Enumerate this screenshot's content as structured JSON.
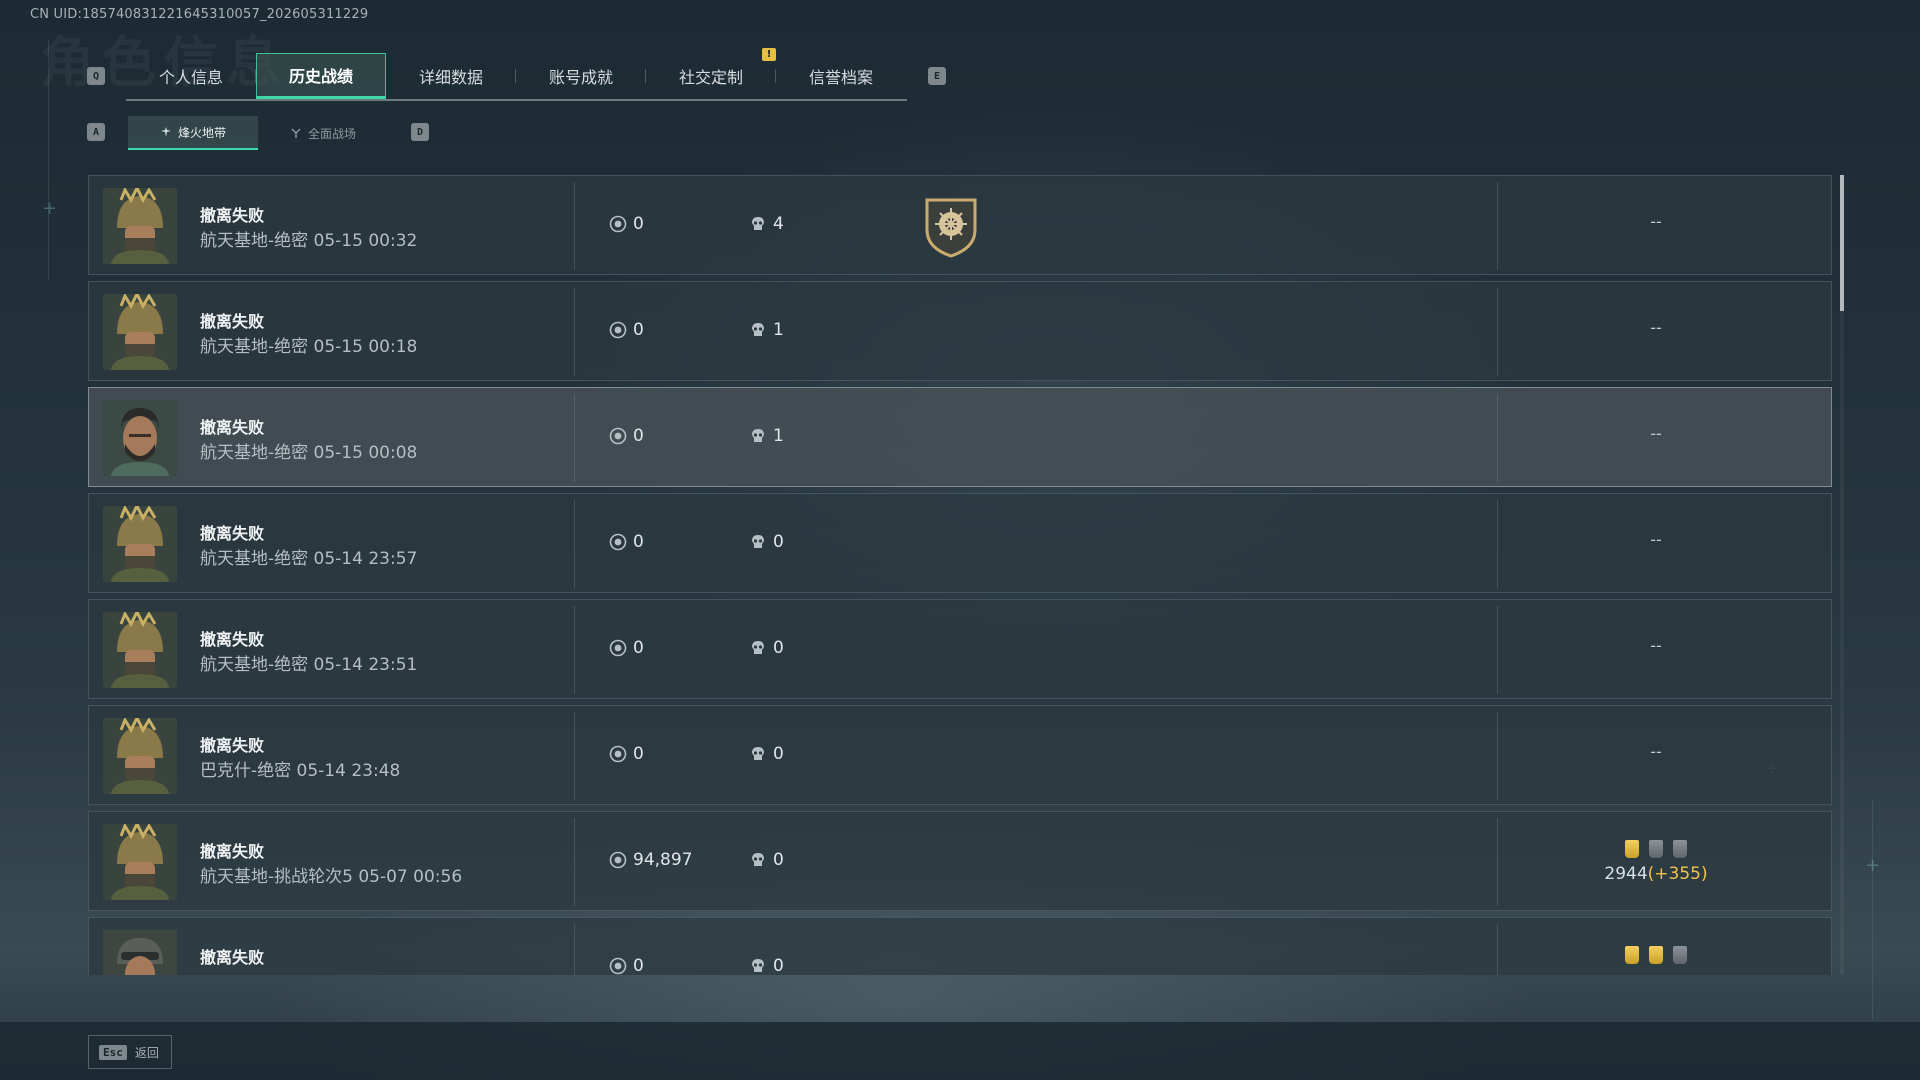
{
  "header": {
    "uid": "CN UID:1857408312216453100​57_202605311229",
    "bg_title": "角色信息"
  },
  "keys": {
    "prev_tab": "Q",
    "next_tab": "E",
    "prev_sub": "A",
    "next_sub": "D"
  },
  "tabs": [
    {
      "label": "个人信息",
      "active": false
    },
    {
      "label": "历史战绩",
      "active": true
    },
    {
      "label": "详细数据",
      "active": false
    },
    {
      "label": "账号成就",
      "active": false
    },
    {
      "label": "社交定制",
      "active": false,
      "notify": "!"
    },
    {
      "label": "信誉档案",
      "active": false
    }
  ],
  "subtabs": [
    {
      "label": "烽火地带",
      "icon": "hazard-zone-icon",
      "active": true
    },
    {
      "label": "全面战场",
      "icon": "battlefield-icon",
      "active": false
    }
  ],
  "matches": [
    {
      "avatar": "helmet-soldier",
      "result": "撤离失败",
      "detail": "航天基地-绝密 05-15 00:32",
      "value": "0",
      "kills": "4",
      "badge": true,
      "rank": "--",
      "highlight": false
    },
    {
      "avatar": "helmet-soldier",
      "result": "撤离失败",
      "detail": "航天基地-绝密 05-15 00:18",
      "value": "0",
      "kills": "1",
      "badge": false,
      "rank": "--",
      "highlight": false
    },
    {
      "avatar": "bearded-soldier",
      "result": "撤离失败",
      "detail": "航天基地-绝密 05-15 00:08",
      "value": "0",
      "kills": "1",
      "badge": false,
      "rank": "--",
      "highlight": true
    },
    {
      "avatar": "helmet-soldier",
      "result": "撤离失败",
      "detail": "航天基地-绝密 05-14 23:57",
      "value": "0",
      "kills": "0",
      "badge": false,
      "rank": "--",
      "highlight": false
    },
    {
      "avatar": "helmet-soldier",
      "result": "撤离失败",
      "detail": "航天基地-绝密 05-14 23:51",
      "value": "0",
      "kills": "0",
      "badge": false,
      "rank": "--",
      "highlight": false
    },
    {
      "avatar": "helmet-soldier",
      "result": "撤离失败",
      "detail": "巴克什-绝密 05-14 23:48",
      "value": "0",
      "kills": "0",
      "badge": false,
      "rank": "--",
      "highlight": false
    },
    {
      "avatar": "helmet-soldier",
      "result": "撤离失败",
      "detail": "航天基地-挑战轮次5 05-07 00:56",
      "value": "94,897",
      "kills": "0",
      "badge": false,
      "medals": [
        "gold",
        "grey",
        "grey"
      ],
      "points": "2944",
      "points_delta": "(+355)",
      "highlight": false
    },
    {
      "avatar": "goggles-soldier",
      "result": "撤离失败",
      "detail": "",
      "value": "0",
      "kills": "0",
      "badge": false,
      "medals": [
        "gold",
        "gold",
        "grey"
      ],
      "highlight": false
    }
  ],
  "footer": {
    "esc_key": "Esc",
    "back_label": "返回"
  },
  "colors": {
    "accent": "#3fd6a8",
    "gold": "#f0c44c"
  }
}
